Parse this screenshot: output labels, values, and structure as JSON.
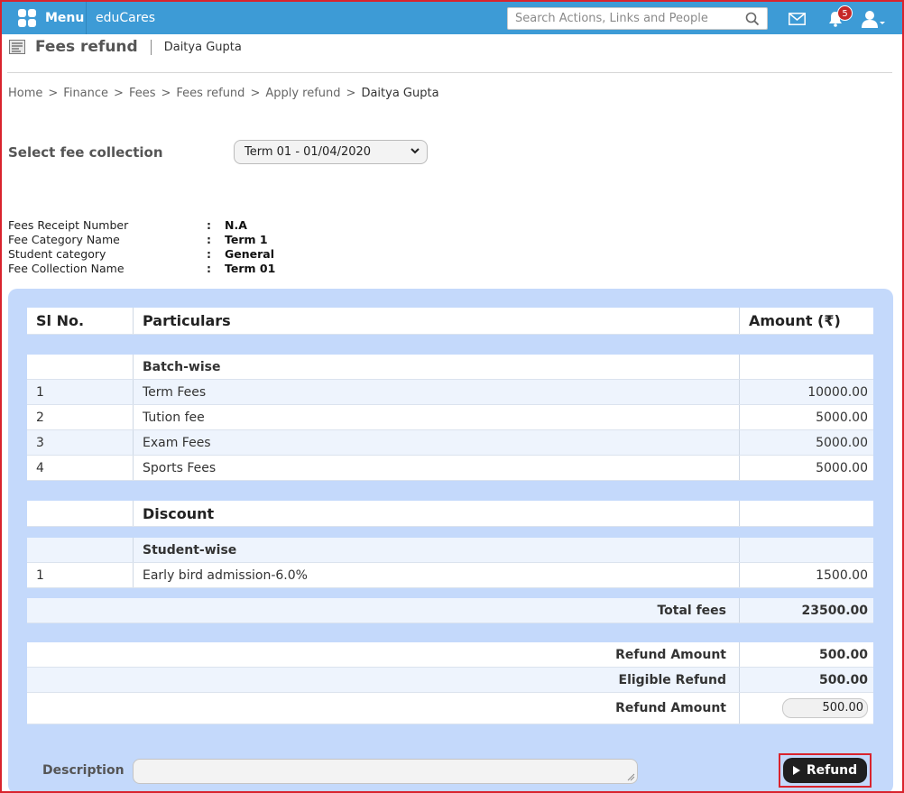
{
  "topbar": {
    "menu_label": "Menu",
    "brand": "eduCares",
    "search_placeholder": "Search Actions, Links and People",
    "notification_count": "5"
  },
  "page": {
    "title": "Fees refund",
    "subtitle": "Daitya Gupta"
  },
  "breadcrumb": [
    "Home",
    "Finance",
    "Fees",
    "Fees refund",
    "Apply refund",
    "Daitya Gupta"
  ],
  "fee_collection": {
    "label": "Select fee collection",
    "selected": "Term 01 - 01/04/2020"
  },
  "info": [
    {
      "label": "Fees Receipt Number",
      "value": "N.A"
    },
    {
      "label": "Fee Category Name",
      "value": "Term 1"
    },
    {
      "label": "Student category",
      "value": "General"
    },
    {
      "label": "Fee Collection Name",
      "value": "Term 01"
    }
  ],
  "table": {
    "headers": {
      "sl": "Sl No.",
      "particulars": "Particulars",
      "amount": "Amount (₹)"
    },
    "group1": "Batch-wise",
    "fees": [
      {
        "sl": "1",
        "name": "Term Fees",
        "amount": "10000.00"
      },
      {
        "sl": "2",
        "name": "Tution fee",
        "amount": "5000.00"
      },
      {
        "sl": "3",
        "name": "Exam Fees",
        "amount": "5000.00"
      },
      {
        "sl": "4",
        "name": "Sports Fees",
        "amount": "5000.00"
      }
    ],
    "discount_title": "Discount",
    "discount_group": "Student-wise",
    "discounts": [
      {
        "sl": "1",
        "name": "Early bird admission-6.0%",
        "amount": "1500.00"
      }
    ],
    "total_label": "Total fees",
    "total_value": "23500.00",
    "refund_amount_label": "Refund Amount",
    "refund_amount_value": "500.00",
    "eligible_label": "Eligible Refund",
    "eligible_value": "500.00",
    "refund_input_label": "Refund Amount",
    "refund_input_value": "500.00"
  },
  "description_label": "Description",
  "refund_button": "Refund"
}
